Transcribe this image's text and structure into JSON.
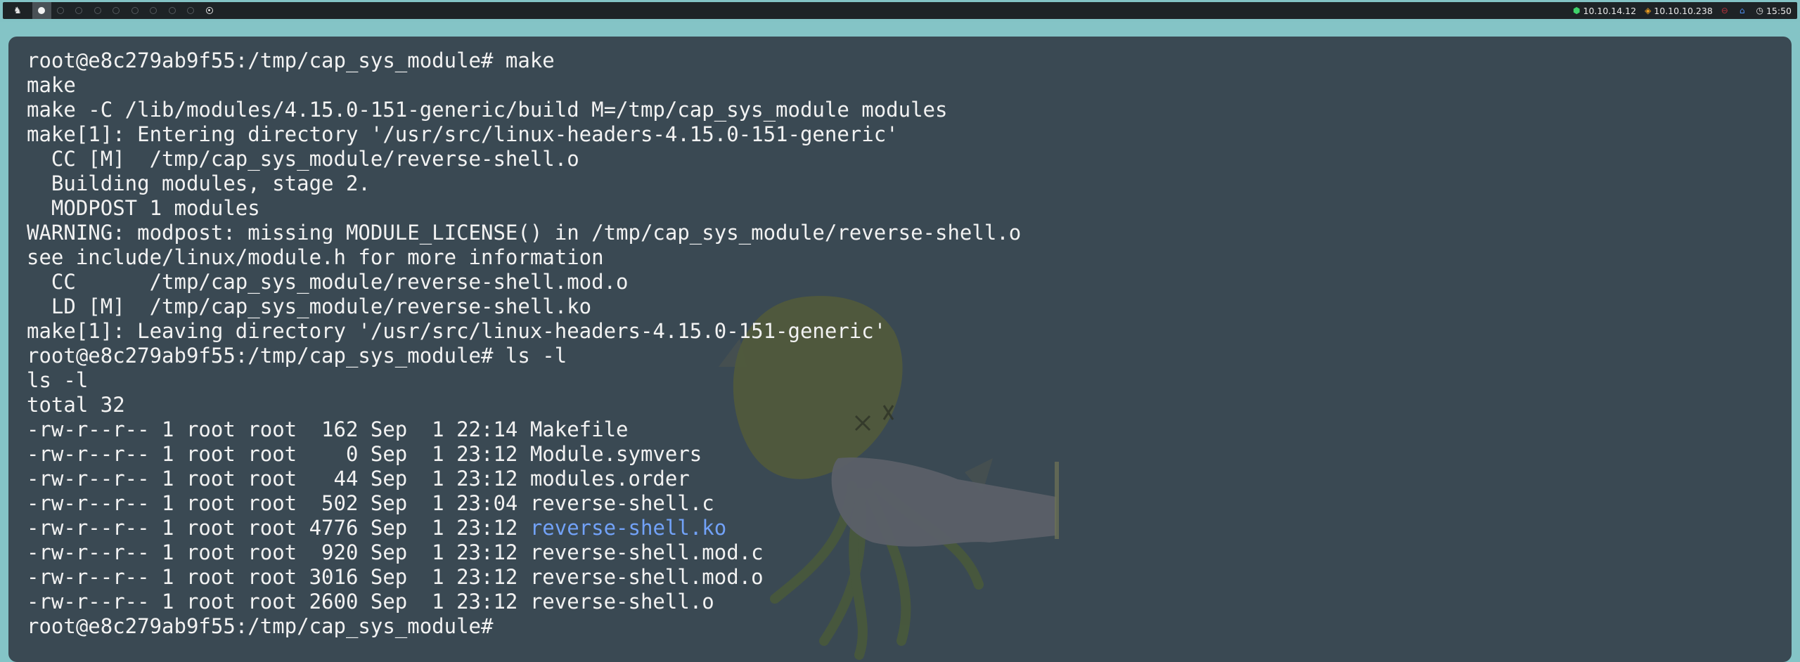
{
  "topbar": {
    "logo": "♞",
    "workspaces": [
      {
        "state": "active"
      },
      {
        "state": "empty"
      },
      {
        "state": "empty"
      },
      {
        "state": "empty"
      },
      {
        "state": "empty"
      },
      {
        "state": "empty"
      },
      {
        "state": "empty"
      },
      {
        "state": "empty"
      },
      {
        "state": "empty"
      },
      {
        "state": "target"
      }
    ],
    "vpn_ip": "10.10.14.12",
    "target_ip": "10.10.10.238",
    "clock": "15:50",
    "colors": {
      "vpn": "#3fd26a",
      "target": "#f0a020",
      "blocked": "#b7333d",
      "home": "#4d8ff0"
    }
  },
  "terminal": {
    "lines": [
      {
        "text": "root@e8c279ab9f55:/tmp/cap_sys_module# make"
      },
      {
        "text": "make"
      },
      {
        "text": "make -C /lib/modules/4.15.0-151-generic/build M=/tmp/cap_sys_module modules"
      },
      {
        "text": "make[1]: Entering directory '/usr/src/linux-headers-4.15.0-151-generic'"
      },
      {
        "text": "  CC [M]  /tmp/cap_sys_module/reverse-shell.o"
      },
      {
        "text": "  Building modules, stage 2."
      },
      {
        "text": "  MODPOST 1 modules"
      },
      {
        "text": "WARNING: modpost: missing MODULE_LICENSE() in /tmp/cap_sys_module/reverse-shell.o"
      },
      {
        "text": "see include/linux/module.h for more information"
      },
      {
        "text": "  CC      /tmp/cap_sys_module/reverse-shell.mod.o"
      },
      {
        "text": "  LD [M]  /tmp/cap_sys_module/reverse-shell.ko"
      },
      {
        "text": "make[1]: Leaving directory '/usr/src/linux-headers-4.15.0-151-generic'"
      },
      {
        "text": "root@e8c279ab9f55:/tmp/cap_sys_module# ls -l"
      },
      {
        "text": "ls -l"
      },
      {
        "text": "total 32"
      },
      {
        "text": "-rw-r--r-- 1 root root  162 Sep  1 22:14 Makefile"
      },
      {
        "text": "-rw-r--r-- 1 root root    0 Sep  1 23:12 Module.symvers"
      },
      {
        "text": "-rw-r--r-- 1 root root   44 Sep  1 23:12 modules.order"
      },
      {
        "text": "-rw-r--r-- 1 root root  502 Sep  1 23:04 reverse-shell.c"
      },
      {
        "text": "-rw-r--r-- 1 root root 4776 Sep  1 23:12 ",
        "highlight": "reverse-shell.ko",
        "highlight_color": "#72a2f8"
      },
      {
        "text": "-rw-r--r-- 1 root root  920 Sep  1 23:12 reverse-shell.mod.c"
      },
      {
        "text": "-rw-r--r-- 1 root root 3016 Sep  1 23:12 reverse-shell.mod.o"
      },
      {
        "text": "-rw-r--r-- 1 root root 2600 Sep  1 23:12 reverse-shell.o"
      },
      {
        "text": "root@e8c279ab9f55:/tmp/cap_sys_module# "
      }
    ],
    "colors": {
      "background": "#3a4953",
      "foreground": "#f2f2f2"
    }
  }
}
